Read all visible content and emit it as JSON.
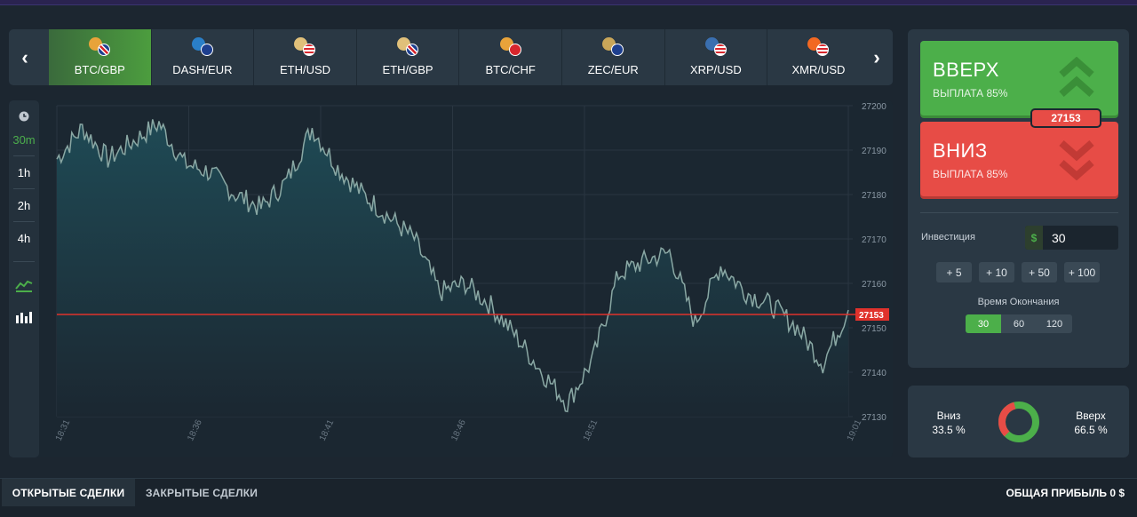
{
  "assets": [
    {
      "label": "BTC/GBP",
      "coin": "#e8a33a",
      "flag": "uk",
      "active": true
    },
    {
      "label": "DASH/EUR",
      "coin": "#2a7fc8",
      "flag": "eu",
      "active": false
    },
    {
      "label": "ETH/USD",
      "coin": "#e0c07a",
      "flag": "us",
      "active": false
    },
    {
      "label": "ETH/GBP",
      "coin": "#e0c07a",
      "flag": "uk",
      "active": false
    },
    {
      "label": "BTC/CHF",
      "coin": "#e8a33a",
      "flag": "ch",
      "active": false
    },
    {
      "label": "ZEC/EUR",
      "coin": "#c9a659",
      "flag": "eu",
      "active": false
    },
    {
      "label": "XRP/USD",
      "coin": "#3a6fb0",
      "flag": "us",
      "active": false
    },
    {
      "label": "XMR/USD",
      "coin": "#f26822",
      "flag": "us",
      "active": false
    }
  ],
  "nav": {
    "prev_icon": "chevron-left-icon",
    "next_icon": "chevron-right-icon"
  },
  "timeframes": {
    "icon": "clock-icon",
    "items": [
      "30m",
      "1h",
      "2h",
      "4h"
    ],
    "active": "30m"
  },
  "chart_tools": {
    "line_icon": "line-chart-icon",
    "bar_icon": "bar-chart-icon"
  },
  "chart_data": {
    "type": "area",
    "title": "",
    "ylim": [
      27130,
      27200
    ],
    "y_ticks": [
      "27200",
      "27190",
      "27180",
      "27170",
      "27160",
      "27150",
      "27140",
      "27130"
    ],
    "x_ticks": [
      "18:31",
      "18:36",
      "18:41",
      "18:46",
      "18:51",
      "19:01"
    ],
    "current_price": "27153",
    "x": [
      "18:31",
      "18:32",
      "18:33",
      "18:34",
      "18:35",
      "18:36",
      "18:37",
      "18:38",
      "18:39",
      "18:40",
      "18:41",
      "18:42",
      "18:43",
      "18:44",
      "18:45",
      "18:46",
      "18:47",
      "18:48",
      "18:49",
      "18:50",
      "18:51",
      "18:52",
      "18:53",
      "18:54",
      "18:55",
      "18:56",
      "18:57",
      "18:58",
      "18:59",
      "19:00",
      "19:01",
      "19:01"
    ],
    "values": [
      27188,
      27195,
      27188,
      27192,
      27196,
      27187,
      27185,
      27180,
      27177,
      27183,
      27195,
      27186,
      27180,
      27175,
      27170,
      27158,
      27160,
      27155,
      27148,
      27140,
      27133,
      27143,
      27162,
      27165,
      27167,
      27151,
      27164,
      27158,
      27155,
      27150,
      27142,
      27154
    ],
    "colors": {
      "line": "#8aa8a4",
      "fill_top": "#1f4a55",
      "fill_bottom": "#1b2731",
      "price_line": "#e0322c",
      "grid": "#2a3641"
    }
  },
  "trade": {
    "up_label": "ВВЕРХ",
    "up_payout": "ВЫПЛАТА 85%",
    "down_label": "ВНИЗ",
    "down_payout": "ВЫПЛАТА 85%",
    "price": "27153",
    "up_icon": "double-chevron-up-icon",
    "down_icon": "double-chevron-down-icon"
  },
  "investment": {
    "label": "Инвестиция",
    "currency": "$",
    "value": "30",
    "increments": [
      "+ 5",
      "+ 10",
      "+ 50",
      "+ 100"
    ]
  },
  "expiry": {
    "label": "Время Окончания",
    "options": [
      "30",
      "60",
      "120"
    ],
    "active": "30"
  },
  "sentiment": {
    "down_label": "Вниз",
    "down_value": "33.5 %",
    "down_fraction": 0.335,
    "up_label": "Вверх",
    "up_value": "66.5 %",
    "up_fraction": 0.665,
    "down_color": "#e74c46",
    "up_color": "#4caf4a"
  },
  "bottom": {
    "open_tab": "ОТКРЫТЫЕ СДЕЛКИ",
    "closed_tab": "ЗАКРЫТЫЕ СДЕЛКИ",
    "profit": "ОБЩАЯ ПРИБЫЛЬ 0 $"
  }
}
